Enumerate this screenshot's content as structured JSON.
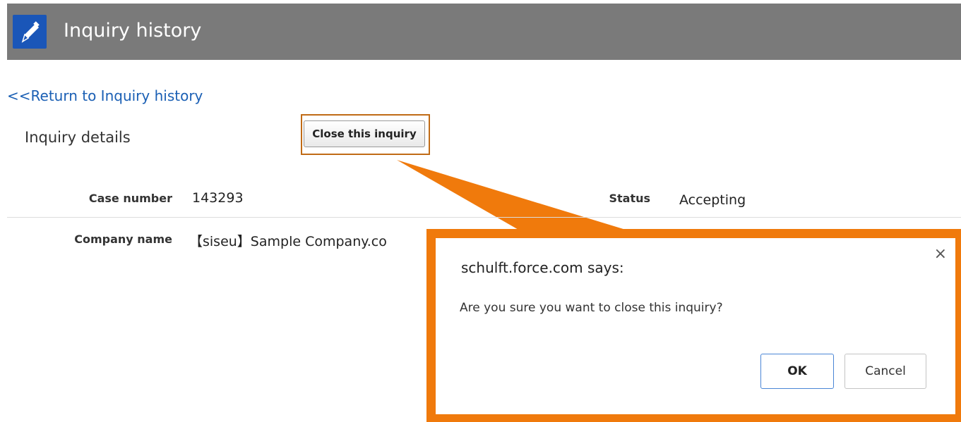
{
  "header": {
    "title": "Inquiry history",
    "icon": "edit-icon"
  },
  "back_link": "<<Return to Inquiry history",
  "section_title": "Inquiry details",
  "close_button": "Close this inquiry",
  "fields": {
    "case_number_label": "Case number",
    "case_number_value": "143293",
    "status_label": "Status",
    "status_value": "Accepting",
    "company_label": "Company name",
    "company_value": "【siseu】Sample Company.co"
  },
  "dialog": {
    "title": "schulft.force.com says:",
    "message": "Are you sure you want to close this inquiry?",
    "ok_label": "OK",
    "cancel_label": "Cancel",
    "close_glyph": "×"
  },
  "colors": {
    "header_bg": "#7a7a7a",
    "icon_bg": "#1a56b8",
    "link": "#1a5fb4",
    "callout": "#f07a0c",
    "highlight_border": "#c06b16"
  }
}
